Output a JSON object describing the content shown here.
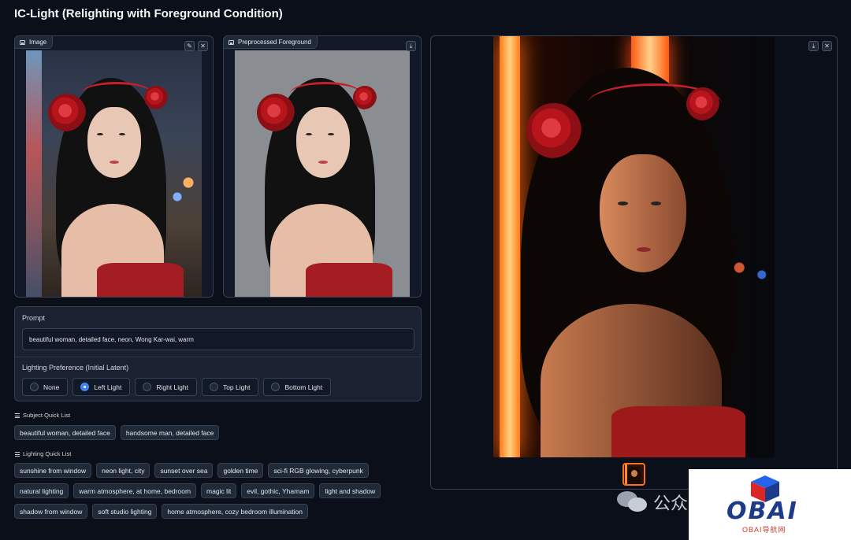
{
  "app": {
    "title": "IC-Light (Relighting with Foreground Condition)"
  },
  "image_panel": {
    "label": "Image",
    "edit_icon": "pencil-icon",
    "close_icon": "close-icon"
  },
  "foreground_panel": {
    "label": "Preprocessed Foreground",
    "download_icon": "download-icon"
  },
  "output_panel": {
    "download_icon": "download-icon",
    "close_icon": "close-icon"
  },
  "prompt": {
    "label": "Prompt",
    "value": "beautiful woman, detailed face, neon, Wong Kar-wai, warm"
  },
  "lighting_preference": {
    "label": "Lighting Preference (Initial Latent)",
    "options": [
      "None",
      "Left Light",
      "Right Light",
      "Top Light",
      "Bottom Light"
    ],
    "selected": "Left Light"
  },
  "subject_quick_list": {
    "label": "Subject Quick List",
    "items": [
      "beautiful woman, detailed face",
      "handsome man, detailed face"
    ]
  },
  "lighting_quick_list": {
    "label": "Lighting Quick List",
    "rows": [
      [
        "sunshine from window",
        "neon light, city",
        "sunset over sea",
        "golden time",
        "sci-fi RGB glowing, cyberpunk"
      ],
      [
        "natural lighting",
        "warm atmosphere, at home, bedroom",
        "magic lit",
        "evil, gothic, Yharnam",
        "light and shadow"
      ],
      [
        "shadow from window",
        "soft studio lighting",
        "home atmosphere, cozy bedroom illumination"
      ]
    ]
  },
  "watermark": {
    "text": "公众",
    "logo_text": "OBAI",
    "logo_sub": "OBAI导航网"
  },
  "colors": {
    "background": "#0b0f19",
    "panel": "#111827",
    "accent": "#3b82f6",
    "thumb_border": "#f97316"
  }
}
